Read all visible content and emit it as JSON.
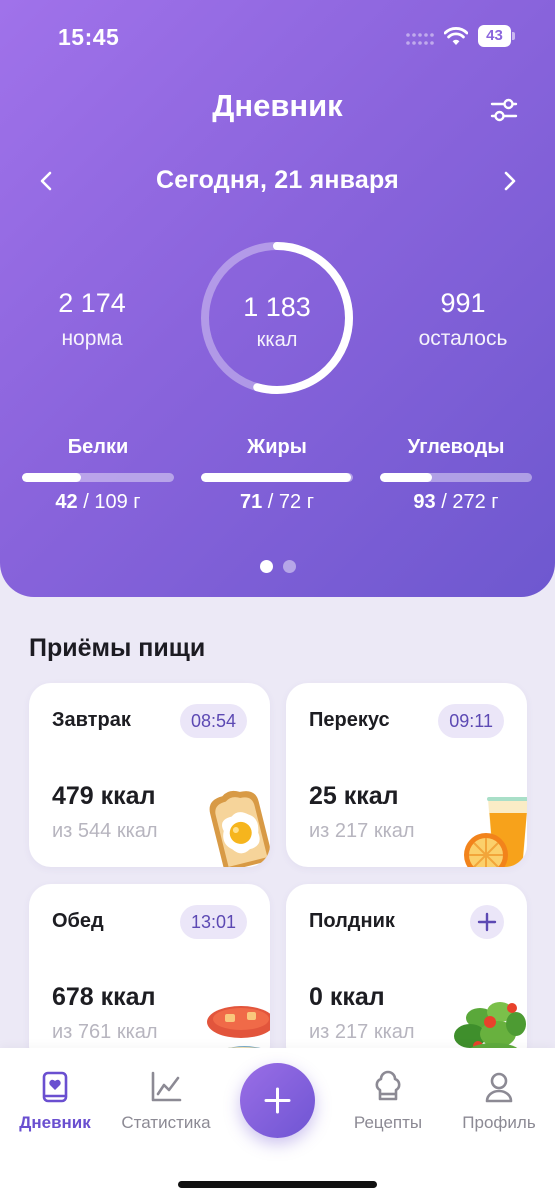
{
  "status_bar": {
    "time": "15:45",
    "battery": "43"
  },
  "header": {
    "title": "Дневник",
    "date_label": "Сегодня,  21 января",
    "norm": {
      "value": "2 174",
      "label": "норма"
    },
    "eaten": {
      "value": "1 183",
      "label": "ккал",
      "progress": 0.544
    },
    "remaining": {
      "value": "991",
      "label": "осталось"
    },
    "macros": [
      {
        "name": "Белки",
        "eaten": "42",
        "goal": "/ 109 г",
        "progress": 0.385
      },
      {
        "name": "Жиры",
        "eaten": "71",
        "goal": "/ 72 г",
        "progress": 0.986
      },
      {
        "name": "Углеводы",
        "eaten": "93",
        "goal": "/ 272 г",
        "progress": 0.342
      }
    ],
    "page_count": 2,
    "active_page": 1
  },
  "meals": {
    "title": "Приёмы пищи",
    "items": [
      {
        "name": "Завтрак",
        "time": "08:54",
        "kcal": "479 ккал",
        "goal": "из 544 ккал"
      },
      {
        "name": "Перекус",
        "time": "09:11",
        "kcal": "25 ккал",
        "goal": "из 217 ккал"
      },
      {
        "name": "Обед",
        "time": "13:01",
        "kcal": "678 ккал",
        "goal": "из 761 ккал"
      },
      {
        "name": "Полдник",
        "kcal": "0 ккал",
        "goal": "из 217 ккал"
      }
    ]
  },
  "tabbar": {
    "items": [
      {
        "label": "Дневник",
        "icon": "diary-heart-icon",
        "active": true
      },
      {
        "label": "Статистика",
        "icon": "chart-line-icon",
        "active": false
      },
      {
        "label": "Рецепты",
        "icon": "chef-hat-icon",
        "active": false
      },
      {
        "label": "Профиль",
        "icon": "profile-icon",
        "active": false
      }
    ],
    "fab_icon": "plus-icon"
  },
  "colors": {
    "accent": "#6a4fd0",
    "header_gradient_start": "#a072ea",
    "header_gradient_end": "#6e58cf",
    "badge_bg": "#ebe6f8"
  }
}
